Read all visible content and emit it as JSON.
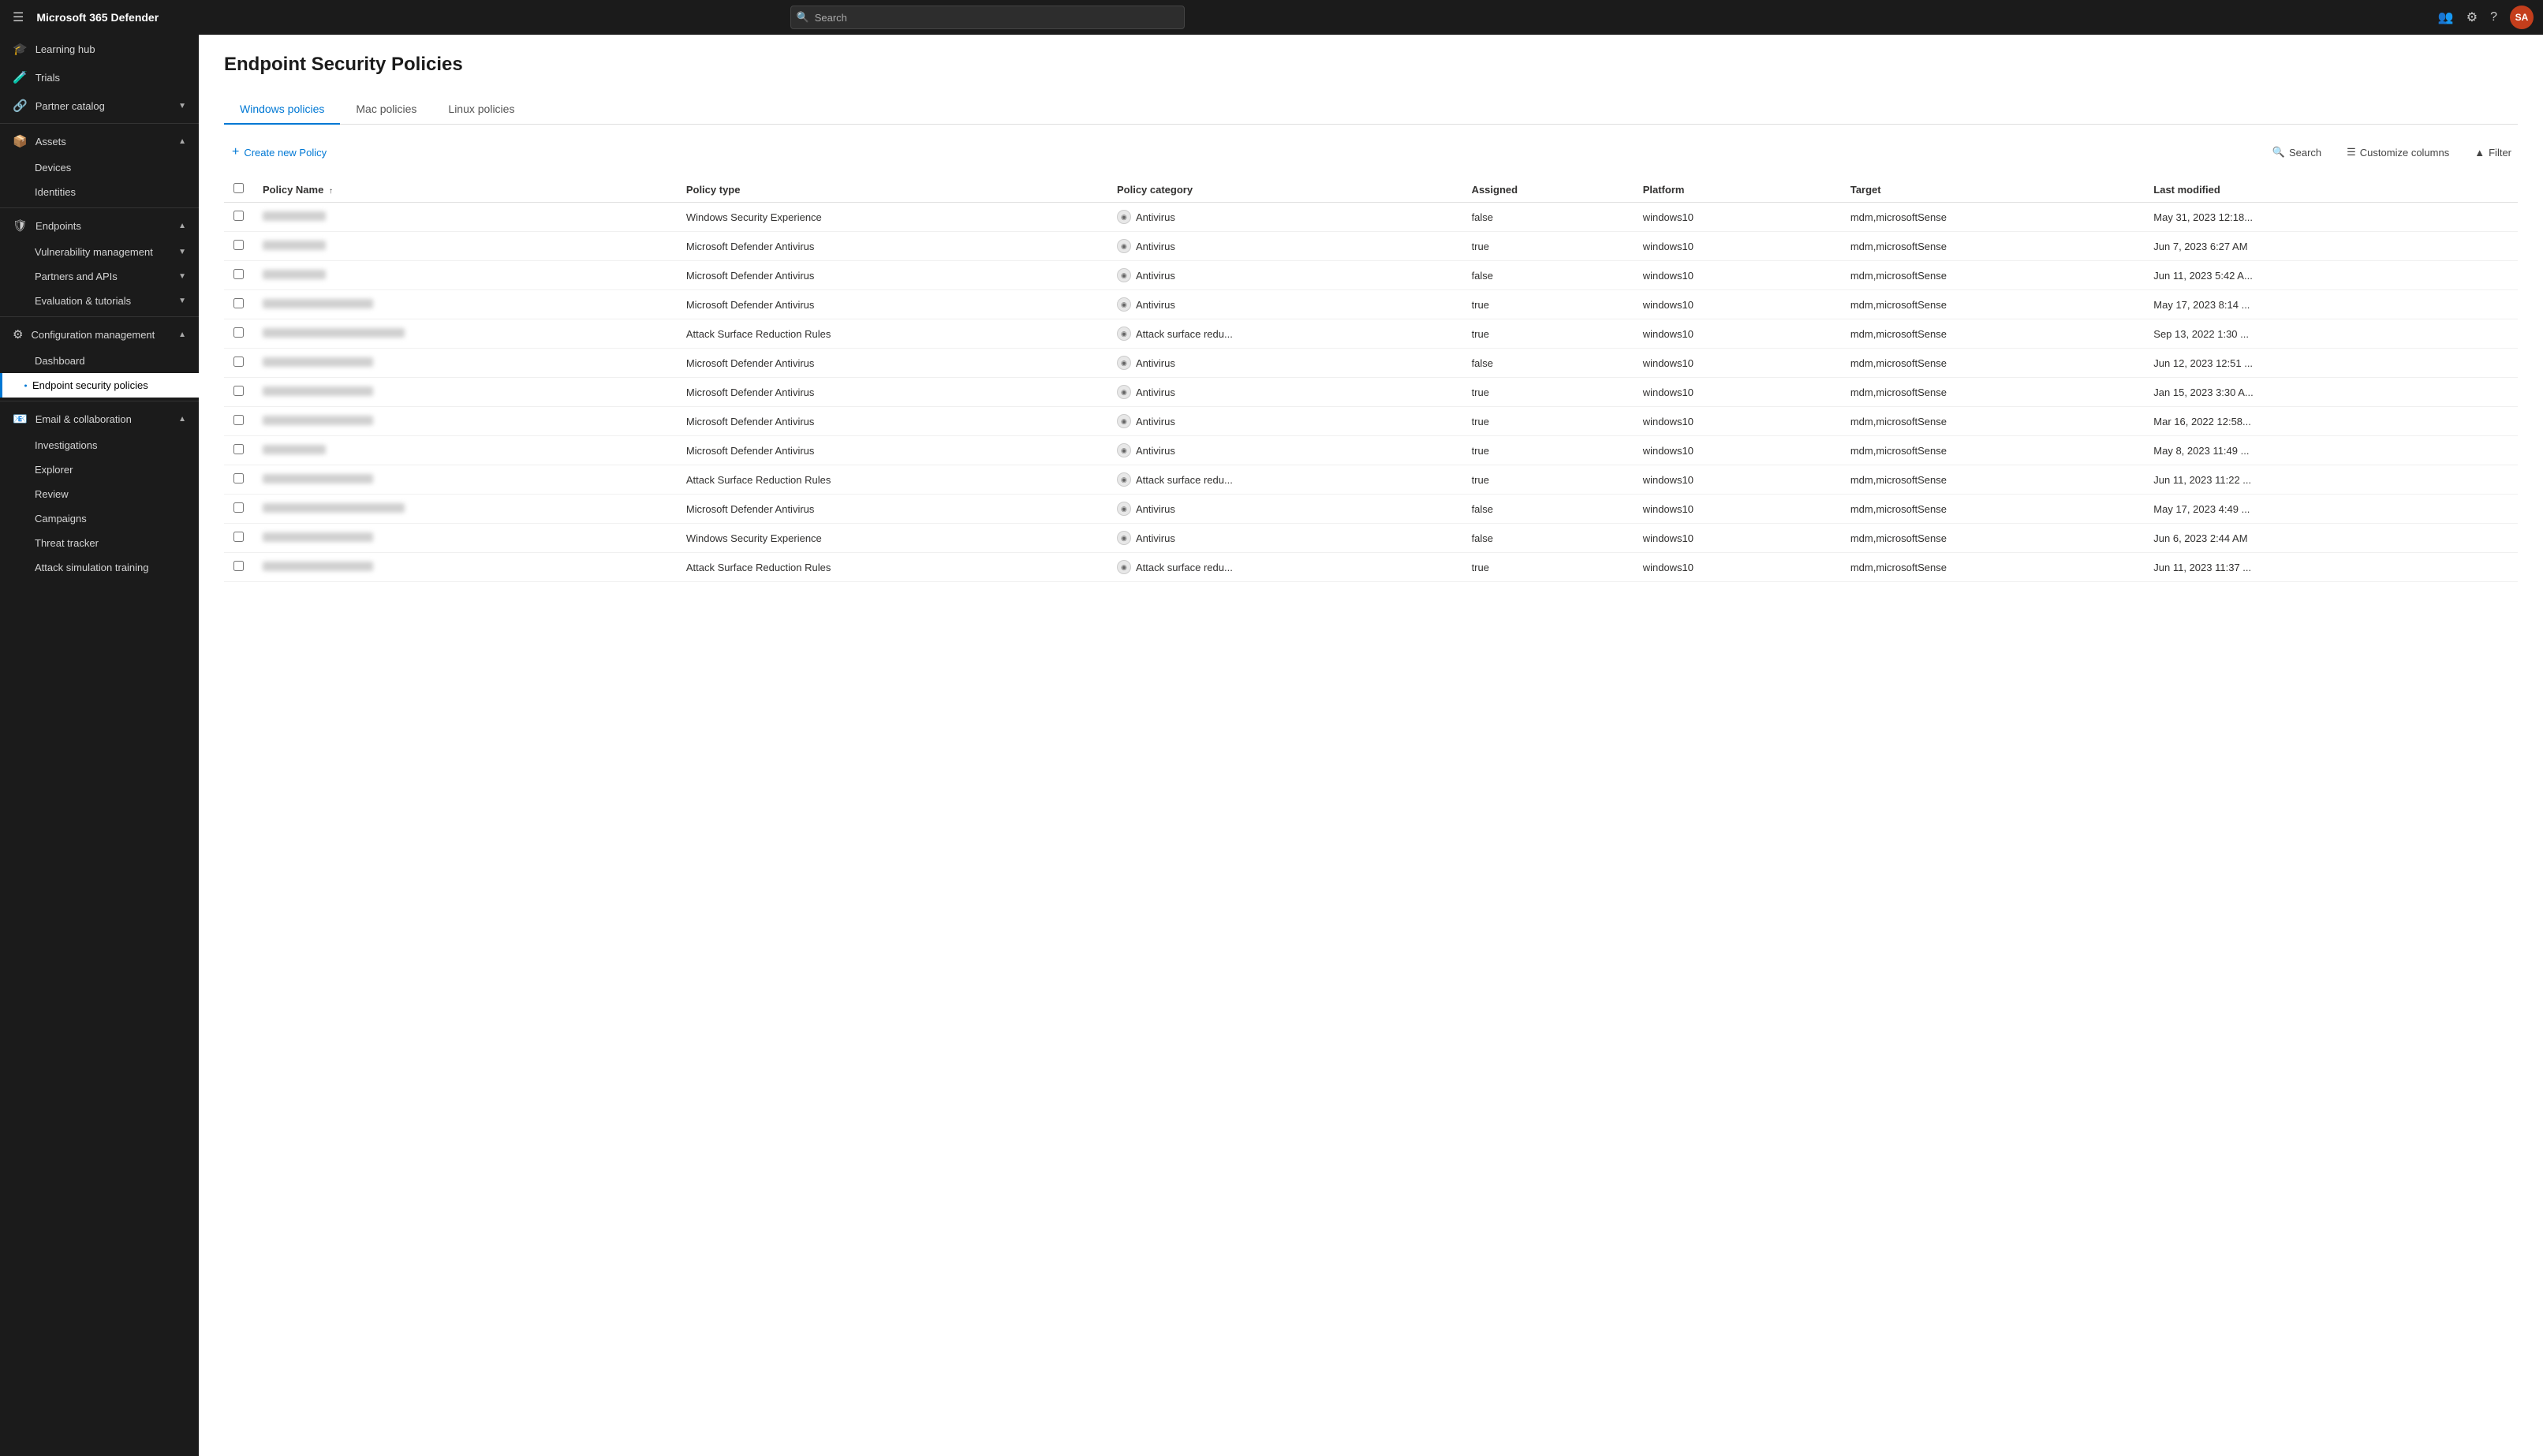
{
  "app": {
    "title": "Microsoft 365 Defender",
    "search_placeholder": "Search",
    "avatar_initials": "SA"
  },
  "topbar": {
    "icons": {
      "apps": "⊞",
      "search": "🔍",
      "settings": "⚙",
      "help": "?",
      "share": "👥"
    }
  },
  "sidebar": {
    "hamburger": "☰",
    "items": [
      {
        "id": "learning-hub",
        "label": "Learning hub",
        "icon": "🎓",
        "expandable": false
      },
      {
        "id": "trials",
        "label": "Trials",
        "icon": "🧪",
        "expandable": false
      },
      {
        "id": "partner-catalog",
        "label": "Partner catalog",
        "icon": "🔗",
        "expandable": true
      },
      {
        "id": "assets",
        "label": "Assets",
        "icon": "📦",
        "expandable": true,
        "expanded": true
      },
      {
        "id": "devices",
        "label": "Devices",
        "icon": "💻",
        "sub": true
      },
      {
        "id": "identities",
        "label": "Identities",
        "icon": "👤",
        "sub": true
      },
      {
        "id": "endpoints",
        "label": "Endpoints",
        "icon": "🛡",
        "expandable": true,
        "expanded": true
      },
      {
        "id": "vulnerability-management",
        "label": "Vulnerability management",
        "icon": "🔍",
        "expandable": true,
        "sub": true
      },
      {
        "id": "partners-apis",
        "label": "Partners and APIs",
        "icon": "🔌",
        "expandable": true,
        "sub": true
      },
      {
        "id": "evaluation-tutorials",
        "label": "Evaluation & tutorials",
        "icon": "📋",
        "expandable": true,
        "sub": true
      },
      {
        "id": "configuration-management",
        "label": "Configuration management",
        "icon": "⚙",
        "expandable": true,
        "expanded": true
      },
      {
        "id": "dashboard",
        "label": "Dashboard",
        "sub2": true
      },
      {
        "id": "endpoint-security-policies",
        "label": "Endpoint security policies",
        "sub2": true,
        "active": true
      },
      {
        "id": "email-collaboration",
        "label": "Email & collaboration",
        "icon": "📧",
        "expandable": true,
        "expanded": true
      },
      {
        "id": "investigations",
        "label": "Investigations",
        "icon": "🔎",
        "sub": true
      },
      {
        "id": "explorer",
        "label": "Explorer",
        "icon": "🗂",
        "sub": true
      },
      {
        "id": "review",
        "label": "Review",
        "icon": "📄",
        "sub": true
      },
      {
        "id": "campaigns",
        "label": "Campaigns",
        "icon": "📢",
        "sub": true
      },
      {
        "id": "threat-tracker",
        "label": "Threat tracker",
        "icon": "📡",
        "sub": true
      },
      {
        "id": "attack-simulation-training",
        "label": "Attack simulation training",
        "icon": "🎯",
        "sub": true
      }
    ]
  },
  "page": {
    "title": "Endpoint Security Policies",
    "tabs": [
      {
        "id": "windows",
        "label": "Windows policies",
        "active": true
      },
      {
        "id": "mac",
        "label": "Mac policies",
        "active": false
      },
      {
        "id": "linux",
        "label": "Linux policies",
        "active": false
      }
    ],
    "create_button": "Create new Policy",
    "toolbar_actions": {
      "search": "Search",
      "customize": "Customize columns",
      "filter": "Filter"
    },
    "table": {
      "columns": [
        {
          "id": "name",
          "label": "Policy Name",
          "sortable": true,
          "sort_dir": "asc"
        },
        {
          "id": "type",
          "label": "Policy type",
          "sortable": false
        },
        {
          "id": "category",
          "label": "Policy category",
          "sortable": false
        },
        {
          "id": "assigned",
          "label": "Assigned",
          "sortable": false
        },
        {
          "id": "platform",
          "label": "Platform",
          "sortable": false
        },
        {
          "id": "target",
          "label": "Target",
          "sortable": false
        },
        {
          "id": "modified",
          "label": "Last modified",
          "sortable": false
        }
      ],
      "rows": [
        {
          "name_width": "short",
          "type": "Windows Security Experience",
          "category": "Antivirus",
          "assigned": "false",
          "platform": "windows10",
          "target": "mdm,microsoftSense",
          "modified": "May 31, 2023 12:18..."
        },
        {
          "name_width": "short",
          "type": "Microsoft Defender Antivirus",
          "category": "Antivirus",
          "assigned": "true",
          "platform": "windows10",
          "target": "mdm,microsoftSense",
          "modified": "Jun 7, 2023 6:27 AM"
        },
        {
          "name_width": "short",
          "type": "Microsoft Defender Antivirus",
          "category": "Antivirus",
          "assigned": "false",
          "platform": "windows10",
          "target": "mdm,microsoftSense",
          "modified": "Jun 11, 2023 5:42 A..."
        },
        {
          "name_width": "medium",
          "type": "Microsoft Defender Antivirus",
          "category": "Antivirus",
          "assigned": "true",
          "platform": "windows10",
          "target": "mdm,microsoftSense",
          "modified": "May 17, 2023 8:14 ..."
        },
        {
          "name_width": "wide",
          "type": "Attack Surface Reduction Rules",
          "category": "Attack surface redu...",
          "assigned": "true",
          "platform": "windows10",
          "target": "mdm,microsoftSense",
          "modified": "Sep 13, 2022 1:30 ..."
        },
        {
          "name_width": "medium",
          "type": "Microsoft Defender Antivirus",
          "category": "Antivirus",
          "assigned": "false",
          "platform": "windows10",
          "target": "mdm,microsoftSense",
          "modified": "Jun 12, 2023 12:51 ..."
        },
        {
          "name_width": "medium",
          "type": "Microsoft Defender Antivirus",
          "category": "Antivirus",
          "assigned": "true",
          "platform": "windows10",
          "target": "mdm,microsoftSense",
          "modified": "Jan 15, 2023 3:30 A..."
        },
        {
          "name_width": "medium",
          "type": "Microsoft Defender Antivirus",
          "category": "Antivirus",
          "assigned": "true",
          "platform": "windows10",
          "target": "mdm,microsoftSense",
          "modified": "Mar 16, 2022 12:58..."
        },
        {
          "name_width": "short",
          "type": "Microsoft Defender Antivirus",
          "category": "Antivirus",
          "assigned": "true",
          "platform": "windows10",
          "target": "mdm,microsoftSense",
          "modified": "May 8, 2023 11:49 ..."
        },
        {
          "name_width": "medium",
          "type": "Attack Surface Reduction Rules",
          "category": "Attack surface redu...",
          "assigned": "true",
          "platform": "windows10",
          "target": "mdm,microsoftSense",
          "modified": "Jun 11, 2023 11:22 ..."
        },
        {
          "name_width": "wide",
          "type": "Microsoft Defender Antivirus",
          "category": "Antivirus",
          "assigned": "false",
          "platform": "windows10",
          "target": "mdm,microsoftSense",
          "modified": "May 17, 2023 4:49 ..."
        },
        {
          "name_width": "medium",
          "type": "Windows Security Experience",
          "category": "Antivirus",
          "assigned": "false",
          "platform": "windows10",
          "target": "mdm,microsoftSense",
          "modified": "Jun 6, 2023 2:44 AM"
        },
        {
          "name_width": "medium",
          "type": "Attack Surface Reduction Rules",
          "category": "Attack surface redu...",
          "assigned": "true",
          "platform": "windows10",
          "target": "mdm,microsoftSense",
          "modified": "Jun 11, 2023 11:37 ..."
        }
      ]
    }
  }
}
